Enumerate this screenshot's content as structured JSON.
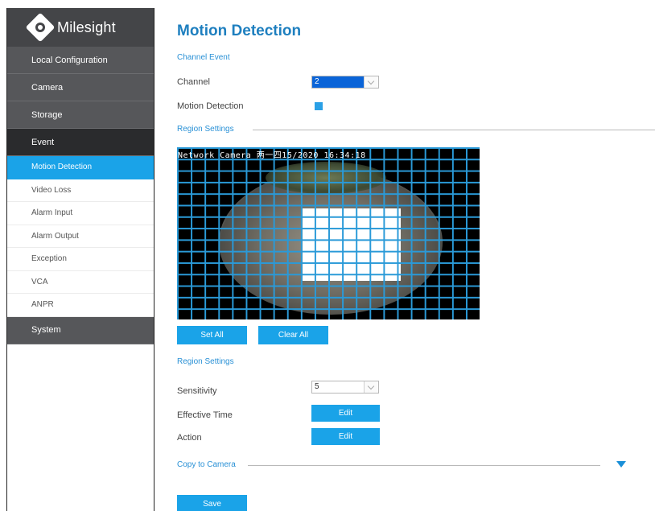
{
  "brand": {
    "name": "Milesight"
  },
  "sidebar": {
    "sections": [
      {
        "label": "Local Configuration"
      },
      {
        "label": "Camera"
      },
      {
        "label": "Storage"
      },
      {
        "label": "Event"
      }
    ],
    "event_items": [
      {
        "label": "Motion Detection"
      },
      {
        "label": "Video Loss"
      },
      {
        "label": "Alarm Input"
      },
      {
        "label": "Alarm Output"
      },
      {
        "label": "Exception"
      },
      {
        "label": "VCA"
      },
      {
        "label": "ANPR"
      }
    ],
    "system": {
      "label": "System"
    }
  },
  "main": {
    "title": "Motion Detection",
    "channel_event_heading": "Channel Event",
    "channel_label": "Channel",
    "channel_value": "2",
    "motion_detection_label": "Motion Detection",
    "region_settings_heading": "Region Settings",
    "osd_text": "Network Camera   两一四15/2020 16:34:18",
    "set_all_label": "Set All",
    "clear_all_label": "Clear All",
    "region_settings_heading2": "Region Settings",
    "sensitivity_label": "Sensitivity",
    "sensitivity_value": "5",
    "effective_time_label": "Effective Time",
    "effective_time_button": "Edit",
    "action_label": "Action",
    "action_button": "Edit",
    "copy_to_camera_label": "Copy to Camera",
    "save_label": "Save"
  },
  "colors": {
    "accent": "#1aa3e8",
    "sidebar_dark": "#444548",
    "heading_blue": "#1e7fbf"
  }
}
